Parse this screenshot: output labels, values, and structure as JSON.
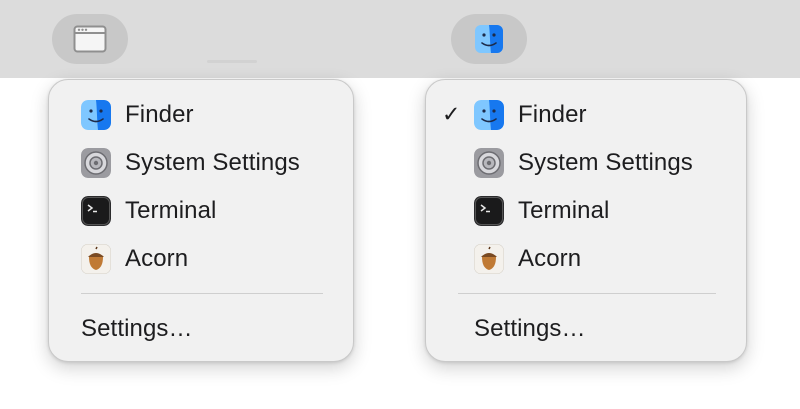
{
  "left_menu": {
    "items": [
      {
        "label": "Finder",
        "icon": "finder-icon",
        "checked": false
      },
      {
        "label": "System Settings",
        "icon": "system-settings-icon",
        "checked": false
      },
      {
        "label": "Terminal",
        "icon": "terminal-icon",
        "checked": false
      },
      {
        "label": "Acorn",
        "icon": "acorn-icon",
        "checked": false
      }
    ],
    "footer_label": "Settings…"
  },
  "right_menu": {
    "items": [
      {
        "label": "Finder",
        "icon": "finder-icon",
        "checked": true
      },
      {
        "label": "System Settings",
        "icon": "system-settings-icon",
        "checked": false
      },
      {
        "label": "Terminal",
        "icon": "terminal-icon",
        "checked": false
      },
      {
        "label": "Acorn",
        "icon": "acorn-icon",
        "checked": false
      }
    ],
    "footer_label": "Settings…"
  },
  "check_glyph": "✓",
  "colors": {
    "menubar": "#dcdcdc",
    "menu_background": "#f1f1f1",
    "finder_blue": "#1e8ef5"
  }
}
